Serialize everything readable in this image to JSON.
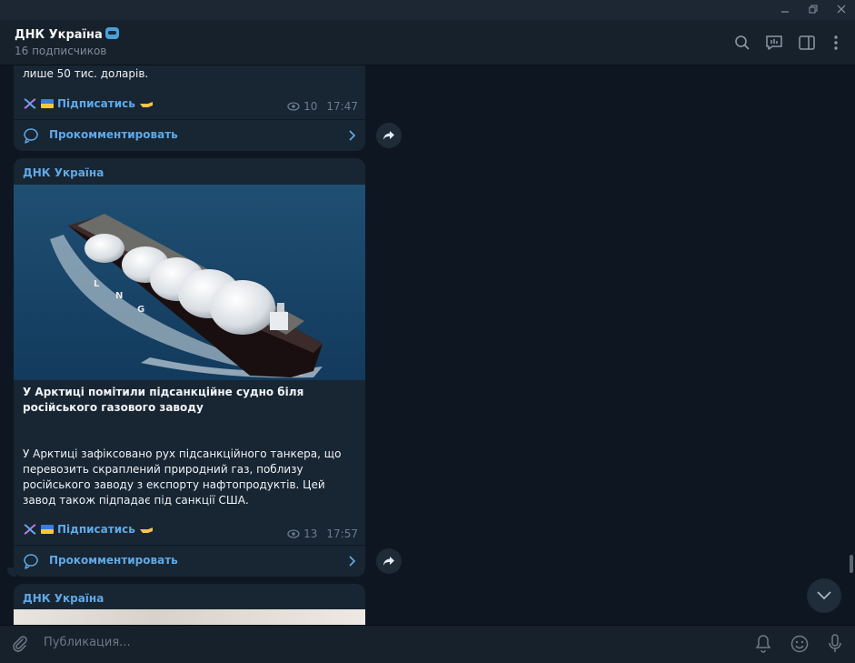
{
  "channel": {
    "title": "ДНК Україна",
    "subtitle": "16 подписчиков"
  },
  "header_icons": [
    "search-icon",
    "live-stream-icon",
    "sidebar-toggle-icon",
    "more-vertical-icon"
  ],
  "posts": [
    {
      "text_tail": "лише 50 тис. доларів.",
      "subscribe_label": "Підписатись",
      "views": "10",
      "time": "17:47",
      "comment_label": "Прокомментировать"
    },
    {
      "sender": "ДНК Україна",
      "headline": "У Арктиці помітили підсанкційне судно біля російського газового заводу",
      "body": "У Арктиці зафіксовано рух підсанкційного танкера, що перевозить скраплений природний газ, поблизу російського заводу з експорту нафтопродуктів. Цей завод також підпадає під санкції США.",
      "ship_letters": [
        "L",
        "N",
        "G"
      ],
      "subscribe_label": "Підписатись",
      "views": "13",
      "time": "17:57",
      "comment_label": "Прокомментировать"
    },
    {
      "sender": "ДНК Україна"
    }
  ],
  "composer": {
    "placeholder": "Публикация..."
  },
  "colors": {
    "background": "#0e1621",
    "bubble": "#182533",
    "accent": "#5fa9e6"
  }
}
